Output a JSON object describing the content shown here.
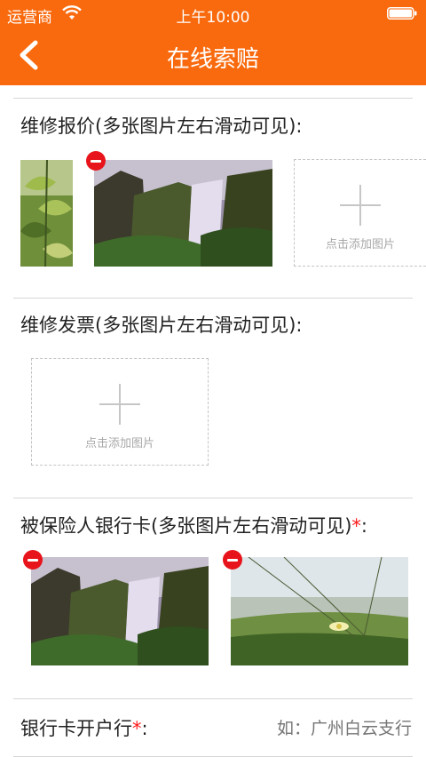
{
  "status_bar": {
    "carrier": "运营商",
    "time": "上午10:00"
  },
  "nav": {
    "title": "在线索赔"
  },
  "sections": {
    "repair_quote": {
      "label": "维修报价(多张图片左右滑动可见):",
      "add_text": "点击添加图片"
    },
    "repair_invoice": {
      "label": "维修发票(多张图片左右滑动可见):",
      "add_text": "点击添加图片"
    },
    "bank_card": {
      "label": "被保险人银行卡(多张图片左右滑动可见)",
      "required_mark": "*",
      "colon": ":"
    },
    "bank_branch": {
      "label": "银行卡开户行",
      "required_mark": "*",
      "colon": ":",
      "placeholder": "如：广州白云支行"
    }
  },
  "icons": {
    "back": "chevron-left-icon",
    "delete": "remove-circle-icon",
    "add": "plus-icon"
  },
  "colors": {
    "header": "#f96a0e",
    "required": "#ff1a1a",
    "delete_badge": "#e8141b"
  }
}
